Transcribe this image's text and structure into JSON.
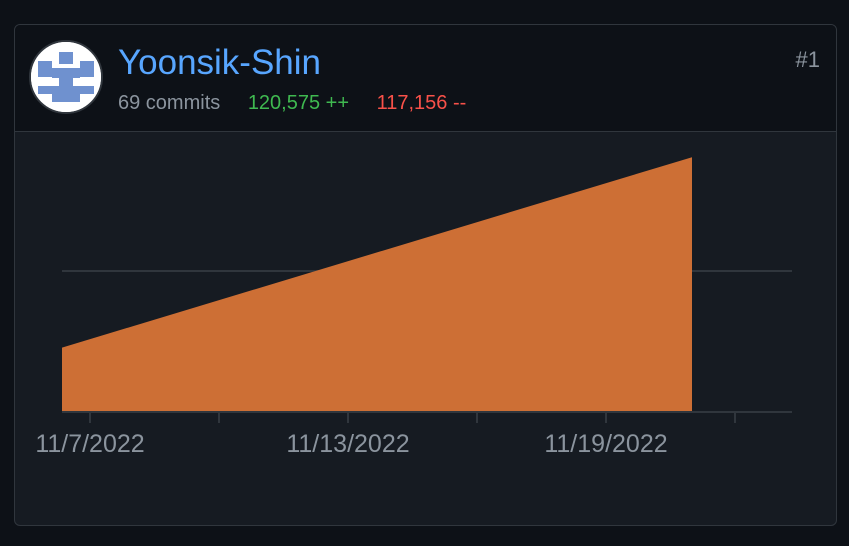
{
  "card": {
    "author": "Yoonsik-Shin",
    "commits": "69 commits",
    "additions": "120,575 ++",
    "deletions": "117,156 --",
    "rank": "#1",
    "avatar_icon": "identicon-avatar"
  },
  "colors": {
    "area": "#cd6f35",
    "link": "#58a6ff",
    "additions": "#3fb950",
    "deletions": "#f85149"
  },
  "chart_data": {
    "type": "area",
    "x": [
      "11/7/2022",
      "11/21/2022"
    ],
    "x_tick_labels": [
      "11/7/2022",
      "11/13/2022",
      "11/19/2022"
    ],
    "series": [
      {
        "values": [
          23,
          91
        ]
      }
    ],
    "ylim": [
      0,
      100
    ],
    "grid": true
  }
}
